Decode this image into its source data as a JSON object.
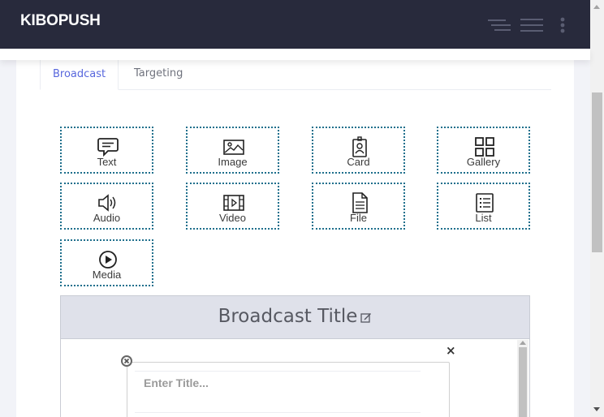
{
  "brand": "KIBOPUSH",
  "header_icons": [
    "hamburger-menu-icon",
    "list-menu-icon",
    "more-vertical-icon"
  ],
  "tabs": [
    {
      "label": "Broadcast",
      "active": true
    },
    {
      "label": "Targeting",
      "active": false
    }
  ],
  "components": [
    {
      "label": "Text",
      "icon": "message-icon"
    },
    {
      "label": "Image",
      "icon": "image-icon"
    },
    {
      "label": "Card",
      "icon": "card-icon"
    },
    {
      "label": "Gallery",
      "icon": "gallery-icon"
    },
    {
      "label": "Audio",
      "icon": "audio-icon"
    },
    {
      "label": "Video",
      "icon": "video-icon"
    },
    {
      "label": "File",
      "icon": "file-icon"
    },
    {
      "label": "List",
      "icon": "list-icon"
    },
    {
      "label": "Media",
      "icon": "media-play-icon"
    }
  ],
  "preview": {
    "title": "Broadcast Title",
    "close_symbol": "×",
    "title_placeholder": "Enter Title..."
  },
  "colors": {
    "header_bg": "#282a3c",
    "accent": "#5867dd",
    "component_border": "#1e6f8c",
    "preview_header_bg": "#dfe1ea"
  }
}
